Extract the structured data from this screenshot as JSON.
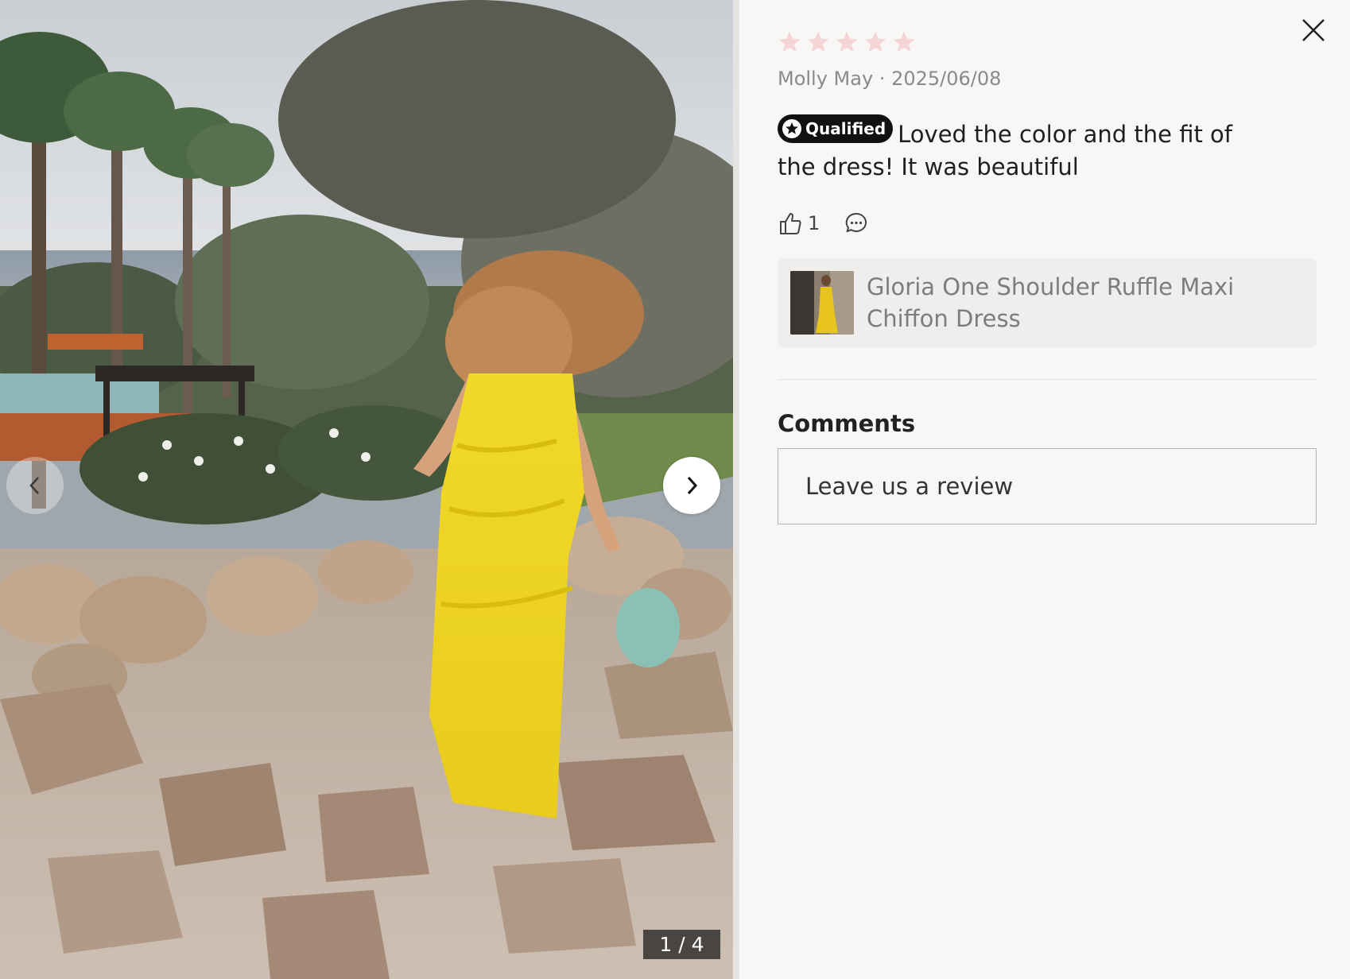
{
  "photo": {
    "counter_text": "1 / 4",
    "current_index": 1,
    "total": 4
  },
  "review": {
    "rating": 5,
    "star_color": "#f4d4d4",
    "author_date": "Molly May · 2025/06/08",
    "badge_label": "Qualified",
    "text": "Loved the color and the fit of the dress! It was beautiful",
    "like_count": "1"
  },
  "product": {
    "name": "Gloria One Shoulder Ruffle Maxi Chiffon Dress"
  },
  "comments": {
    "title": "Comments",
    "input_placeholder": "Leave us a review"
  },
  "icons": {
    "close": "close-icon",
    "prev": "chevron-left-icon",
    "next": "chevron-right-icon",
    "like": "thumbs-up-icon",
    "comment": "comment-bubble-icon",
    "badge": "badge-star-icon",
    "star": "star-icon"
  }
}
